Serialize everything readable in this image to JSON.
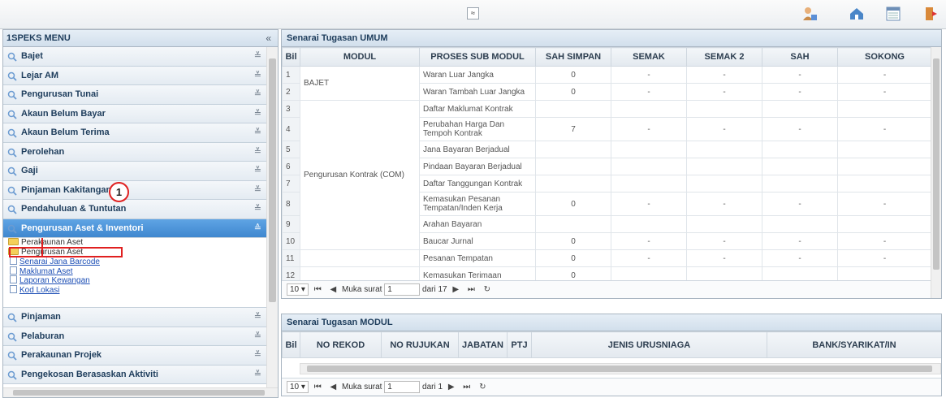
{
  "topbar": {
    "collapse_glyph": "≈",
    "icons": [
      "user-icon",
      "home-icon",
      "calendar-icon",
      "logout-icon"
    ]
  },
  "sidebar": {
    "title": "1SPEKS MENU",
    "collapse_glyph": "«",
    "items_before": [
      {
        "label": "Bajet"
      },
      {
        "label": "Lejar AM"
      },
      {
        "label": "Pengurusan Tunai"
      },
      {
        "label": "Akaun Belum Bayar"
      },
      {
        "label": "Akaun Belum Terima"
      },
      {
        "label": "Perolehan"
      },
      {
        "label": "Gaji"
      },
      {
        "label": "Pinjaman Kakitangan"
      },
      {
        "label": "Pendahuluan & Tuntutan"
      }
    ],
    "active_item": "Pengurusan Aset & Inventori",
    "submenu": {
      "folders": [
        "Perakaunan Aset",
        "Pengurusan Aset"
      ],
      "links": [
        "Senarai Jana Barcode",
        "Maklumat Aset",
        "Laporan Kewangan",
        "Kod Lokasi"
      ]
    },
    "items_after": [
      {
        "label": "Pinjaman"
      },
      {
        "label": "Pelaburan"
      },
      {
        "label": "Perakaunan Projek"
      },
      {
        "label": "Pengekosan Berasaskan Aktiviti"
      }
    ],
    "chev_down": "≚",
    "chev_up": "≙",
    "callout_number": "1"
  },
  "umum": {
    "title": "Senarai Tugasan UMUM",
    "columns": [
      "Bil",
      "MODUL",
      "PROSES SUB MODUL",
      "SAH SIMPAN",
      "SEMAK",
      "SEMAK 2",
      "SAH",
      "SOKONG"
    ],
    "rows": [
      {
        "bil": "1",
        "proses": "Waran Luar Jangka",
        "sah_simpan": "0",
        "semak": "-",
        "semak2": "-",
        "sah": "-",
        "sokong": "-"
      },
      {
        "bil": "2",
        "proses": "Waran Tambah Luar Jangka",
        "sah_simpan": "0",
        "semak": "-",
        "semak2": "-",
        "sah": "-",
        "sokong": "-"
      },
      {
        "bil": "3",
        "proses": "Daftar Maklumat Kontrak",
        "sah_simpan": "",
        "semak": "",
        "semak2": "",
        "sah": "",
        "sokong": ""
      },
      {
        "bil": "4",
        "proses": "Perubahan Harga Dan Tempoh Kontrak",
        "sah_simpan": "7",
        "semak": "-",
        "semak2": "-",
        "sah": "-",
        "sokong": "-"
      },
      {
        "bil": "5",
        "proses": "Jana Bayaran Berjadual",
        "sah_simpan": "",
        "semak": "",
        "semak2": "",
        "sah": "",
        "sokong": ""
      },
      {
        "bil": "6",
        "proses": "Pindaan Bayaran Berjadual",
        "sah_simpan": "",
        "semak": "",
        "semak2": "",
        "sah": "",
        "sokong": ""
      },
      {
        "bil": "7",
        "proses": "Daftar Tanggungan Kontrak",
        "sah_simpan": "",
        "semak": "",
        "semak2": "",
        "sah": "",
        "sokong": ""
      },
      {
        "bil": "8",
        "proses": "Kemasukan Pesanan Tempatan/Inden Kerja",
        "sah_simpan": "0",
        "semak": "-",
        "semak2": "-",
        "sah": "-",
        "sokong": "-"
      },
      {
        "bil": "9",
        "proses": "Arahan Bayaran",
        "sah_simpan": "",
        "semak": "",
        "semak2": "",
        "sah": "",
        "sokong": ""
      },
      {
        "bil": "10",
        "proses": "Baucar Jurnal",
        "sah_simpan": "0",
        "semak": "-",
        "semak2": "-",
        "sah": "-",
        "sokong": "-"
      },
      {
        "bil": "11",
        "proses": "Pesanan Tempatan",
        "sah_simpan": "0",
        "semak": "-",
        "semak2": "-",
        "sah": "-",
        "sokong": "-"
      },
      {
        "bil": "12",
        "proses": "Kemasukan Terimaan",
        "sah_simpan": "0",
        "semak": "",
        "semak2": "",
        "sah": "",
        "sokong": ""
      }
    ],
    "modul_groups": [
      {
        "label": "BAJET",
        "start": 0,
        "span": 2
      },
      {
        "label": "Pengurusan Kontrak (COM)",
        "start": 2,
        "span": 8
      }
    ],
    "pager": {
      "page_size": "10",
      "page_label": "Muka surat",
      "page": "1",
      "of_label": "dari 17"
    }
  },
  "modul": {
    "title": "Senarai Tugasan MODUL",
    "columns": [
      "Bil",
      "NO REKOD",
      "NO RUJUKAN",
      "JABATAN",
      "PTJ",
      "JENIS URUSNIAGA",
      "BANK/SYARIKAT/IN"
    ],
    "pager": {
      "page_size": "10",
      "page_label": "Muka surat",
      "page": "1",
      "of_label": "dari 1"
    }
  }
}
